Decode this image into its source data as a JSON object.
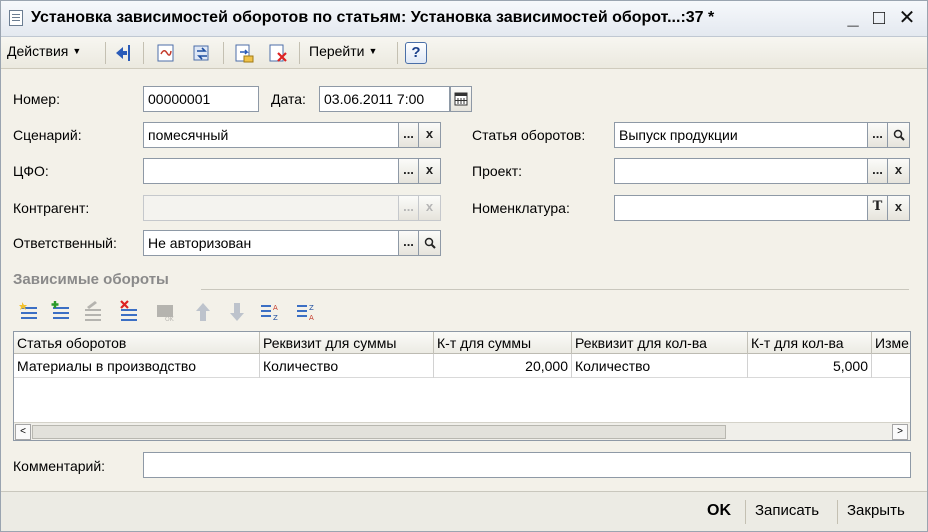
{
  "window": {
    "title": "Установка зависимостей оборотов по статьям: Установка зависимостей оборот...:37 *",
    "controls": {
      "minimize": "_",
      "maximize": "□",
      "close": "✕"
    }
  },
  "toolbar": {
    "actions_label": "Действия",
    "goto_label": "Перейти",
    "help_label": "?"
  },
  "form": {
    "number": {
      "label": "Номер:",
      "value": "00000001"
    },
    "date": {
      "label": "Дата:",
      "value": "03.06.2011  7:00"
    },
    "scenario": {
      "label": "Сценарий:",
      "value": "помесячный"
    },
    "cfo": {
      "label": "ЦФО:",
      "value": ""
    },
    "counterparty": {
      "label": "Контрагент:",
      "value": ""
    },
    "responsible": {
      "label": "Ответственный:",
      "value": "Не авторизован"
    },
    "turnover_item": {
      "label": "Статья оборотов:",
      "value": "Выпуск продукции"
    },
    "project": {
      "label": "Проект:",
      "value": ""
    },
    "nomenclature": {
      "label": "Номенклатура:",
      "value": ""
    },
    "field_buttons": {
      "select": "...",
      "clear": "x",
      "open": "🔍",
      "type": "T"
    }
  },
  "dependent": {
    "title": "Зависимые обороты",
    "columns": [
      "Статья оборотов",
      "Реквизит для суммы",
      "К-т  для суммы",
      "Реквизит для кол-ва",
      "К-т для кол-ва",
      "Изме"
    ],
    "rows": [
      [
        "Материалы в производство",
        "Количество",
        "20,000",
        "Количество",
        "5,000",
        ""
      ]
    ],
    "scroll_left": "<",
    "scroll_right": ">"
  },
  "comment": {
    "label": "Комментарий:",
    "value": ""
  },
  "footer": {
    "ok": "OK",
    "save": "Записать",
    "close": "Закрыть"
  }
}
